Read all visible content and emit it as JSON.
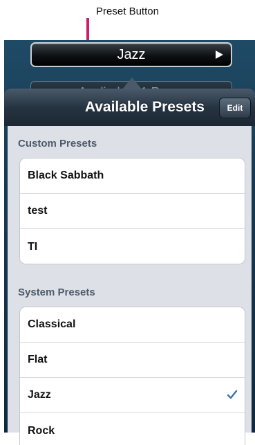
{
  "annotation": {
    "label": "Preset Button"
  },
  "preset_button": {
    "label": "Jazz"
  },
  "applied_bar": {
    "text": "Applied to: 1 Room"
  },
  "popover": {
    "title": "Available Presets",
    "edit_label": "Edit",
    "sections": [
      {
        "header": "Custom Presets",
        "items": [
          "Black Sabbath",
          "test",
          "TI"
        ]
      },
      {
        "header": "System Presets",
        "items": [
          "Classical",
          "Flat",
          "Jazz",
          "Rock"
        ],
        "selected": "Jazz"
      }
    ]
  },
  "colors": {
    "accent_check": "#3b6fb0",
    "arrow": "#cc1f6a",
    "header_bg": "#263442",
    "body_bg": "#dde1e7"
  },
  "icons": [
    "down-arrow-icon",
    "play-icon",
    "checkmark-icon"
  ]
}
